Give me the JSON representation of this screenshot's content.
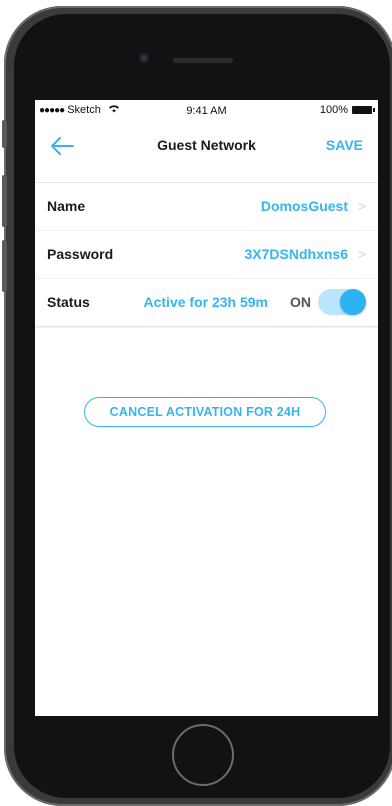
{
  "statusbar": {
    "carrier": "Sketch",
    "time": "9:41 AM",
    "battery": "100%"
  },
  "navbar": {
    "title": "Guest Network",
    "save_label": "SAVE"
  },
  "rows": [
    {
      "label": "Name",
      "value": "DomosGuest"
    },
    {
      "label": "Password",
      "value": "3X7DSNdhxns6"
    },
    {
      "label": "Status",
      "value": "Active for 23h 59m",
      "toggle_label": "ON",
      "toggle_on": true
    }
  ],
  "actions": {
    "cancel_label": "CANCEL ACTIVATION FOR 24H"
  },
  "colors": {
    "accent": "#35b5f0",
    "toggle_track": "#b9e6fb",
    "toggle_knob": "#2db3f1"
  },
  "icons": [
    "back-arrow-icon",
    "chevron-right-icon",
    "wifi-icon",
    "battery-icon",
    "signal-dots-icon"
  ]
}
